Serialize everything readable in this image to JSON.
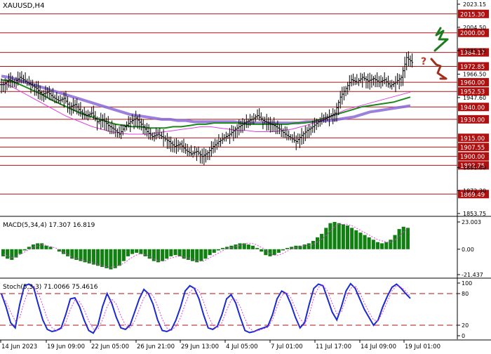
{
  "chart_data": [
    {
      "type": "line",
      "title": "XAUUSD,H4",
      "xlabel": "",
      "ylabel": "",
      "ylim": [
        1853.75,
        2023.15
      ],
      "yticks": [
        {
          "value": 2023.15,
          "label": "2023.15"
        },
        {
          "value": 2004.5,
          "label": "2004.50"
        },
        {
          "value": 1985.55,
          "label": "1985.55"
        },
        {
          "value": 1966.5,
          "label": "1966.50"
        },
        {
          "value": 1947.6,
          "label": "1947.60"
        },
        {
          "value": 1891.0,
          "label": "1891.00"
        },
        {
          "value": 1872.3,
          "label": "1872.30"
        },
        {
          "value": 1853.75,
          "label": "1853.75"
        }
      ],
      "categories": [
        "14 Jun 2023",
        "19 Jun 09:00",
        "22 Jun 05:00",
        "26 Jun 21:00",
        "29 Jun 13:00",
        "4 Jul 05:00",
        "7 Jul 01:00",
        "11 Jul 17:00",
        "14 Jul 09:00",
        "19 Jul 01:00"
      ],
      "levels": [
        {
          "value": 2015.3,
          "label": "2015.30"
        },
        {
          "value": 2000.0,
          "label": "2000.00"
        },
        {
          "value": 1984.17,
          "label": "1984.17"
        },
        {
          "value": 1972.85,
          "label": "1972.85"
        },
        {
          "value": 1960.0,
          "label": "1960.00"
        },
        {
          "value": 1952.53,
          "label": "1952.53"
        },
        {
          "value": 1940.0,
          "label": "1940.00"
        },
        {
          "value": 1930.0,
          "label": "1930.00"
        },
        {
          "value": 1915.0,
          "label": "1915.00"
        },
        {
          "value": 1907.55,
          "label": "1907.55"
        },
        {
          "value": 1900.0,
          "label": "1900.00"
        },
        {
          "value": 1892.75,
          "label": "1892.75"
        },
        {
          "value": 1869.49,
          "label": "1869.49"
        }
      ],
      "close": [
        1958,
        1962,
        1960,
        1964,
        1961,
        1958,
        1955,
        1950,
        1952,
        1948,
        1945,
        1947,
        1940,
        1942,
        1936,
        1933,
        1935,
        1928,
        1930,
        1925,
        1922,
        1918,
        1924,
        1928,
        1931,
        1926,
        1920,
        1916,
        1918,
        1915,
        1912,
        1908,
        1910,
        1905,
        1902,
        1904,
        1900,
        1903,
        1908,
        1912,
        1915,
        1918,
        1922,
        1925,
        1928,
        1930,
        1933,
        1929,
        1927,
        1925,
        1922,
        1918,
        1915,
        1912,
        1917,
        1921,
        1924,
        1928,
        1930,
        1932,
        1935,
        1948,
        1955,
        1962,
        1960,
        1964,
        1961,
        1963,
        1960,
        1962,
        1957,
        1960,
        1964,
        1980,
        1976
      ],
      "series": [
        {
          "name": "",
          "color": "#8a6ad8",
          "values": [
            1965,
            1964,
            1962,
            1960,
            1958,
            1956,
            1954,
            1952,
            1950,
            1948,
            1946,
            1944,
            1942,
            1940,
            1938,
            1936,
            1934,
            1933,
            1932,
            1931,
            1930,
            1930,
            1929,
            1929,
            1928,
            1928,
            1928,
            1928,
            1928,
            1928,
            1927,
            1927,
            1927,
            1927,
            1927,
            1927,
            1927,
            1927,
            1928,
            1928,
            1929,
            1929,
            1930,
            1931,
            1932,
            1934,
            1936,
            1937,
            1938,
            1939,
            1940,
            1941
          ]
        },
        {
          "name": "",
          "color": "#1a8a1a",
          "values": [
            1962,
            1961,
            1959,
            1956,
            1953,
            1950,
            1946,
            1943,
            1940,
            1937,
            1934,
            1932,
            1930,
            1928,
            1926,
            1925,
            1924,
            1924,
            1923,
            1923,
            1923,
            1924,
            1924,
            1925,
            1926,
            1926,
            1927,
            1927,
            1927,
            1927,
            1926,
            1926,
            1926,
            1926,
            1926,
            1926,
            1927,
            1927,
            1928,
            1930,
            1932,
            1934,
            1936,
            1938,
            1940,
            1941,
            1942,
            1943,
            1944,
            1946,
            1948
          ]
        },
        {
          "name": "",
          "color": "#e040e0",
          "values": [
            1960,
            1957,
            1953,
            1949,
            1945,
            1941,
            1937,
            1933,
            1930,
            1927,
            1924,
            1922,
            1920,
            1919,
            1918,
            1918,
            1918,
            1919,
            1920,
            1921,
            1922,
            1923,
            1924,
            1924,
            1923,
            1922,
            1921,
            1921,
            1920,
            1920,
            1920,
            1921,
            1922,
            1924,
            1926,
            1929,
            1932,
            1935,
            1938,
            1940,
            1942,
            1944,
            1946,
            1948,
            1950,
            1952
          ]
        }
      ],
      "annotations": [
        "?"
      ]
    },
    {
      "type": "bar",
      "title": "MACD(5,34,4) 17.307 16.819",
      "ylim": [
        -21.437,
        23.003
      ],
      "yticks": [
        {
          "value": 23.003,
          "label": "23.003"
        },
        {
          "value": 0.0,
          "label": "0.00"
        },
        {
          "value": -21.437,
          "label": "-21.437"
        }
      ],
      "values": [
        -6,
        -8,
        -9,
        -7,
        -4,
        -1,
        2,
        4,
        5,
        5,
        3,
        2,
        0,
        -2,
        -4,
        -6,
        -8,
        -9,
        -10,
        -11,
        -12,
        -13,
        -14,
        -15,
        -16,
        -17,
        -16,
        -14,
        -10,
        -6,
        -4,
        -3,
        -4,
        -6,
        -8,
        -10,
        -11,
        -10,
        -8,
        -6,
        -5,
        -6,
        -8,
        -9,
        -10,
        -11,
        -10,
        -8,
        -5,
        -3,
        -1,
        1,
        2,
        3,
        4,
        5,
        5,
        4,
        3,
        1,
        -2,
        -5,
        -6,
        -5,
        -3,
        -1,
        1,
        2,
        3,
        3,
        4,
        5,
        7,
        10,
        13,
        18,
        22,
        23,
        22,
        21,
        20,
        18,
        16,
        14,
        12,
        10,
        8,
        6,
        5,
        6,
        8,
        12,
        17,
        19,
        18
      ],
      "series": [
        {
          "name": "",
          "color": "#e040e0",
          "values": [
            -4,
            -6,
            -7,
            -6,
            -4,
            -2,
            0,
            2,
            3,
            4,
            3,
            2,
            1,
            -1,
            -3,
            -5,
            -7,
            -8,
            -9,
            -10,
            -11,
            -12,
            -13,
            -14,
            -15,
            -15,
            -14,
            -13,
            -11,
            -8,
            -6,
            -4,
            -4,
            -5,
            -7,
            -9,
            -10,
            -10,
            -8,
            -7,
            -6,
            -6,
            -7,
            -8,
            -9,
            -10,
            -10,
            -8,
            -6,
            -4,
            -2,
            0,
            1,
            2,
            3,
            4,
            5,
            5,
            4,
            2,
            0,
            -3,
            -5,
            -5,
            -4,
            -2,
            0,
            1,
            2,
            3,
            3,
            4,
            6,
            8,
            11,
            15,
            19,
            21,
            21,
            21,
            20,
            18,
            16,
            14,
            12,
            10,
            8,
            7,
            6,
            6,
            8,
            11,
            15,
            17
          ]
        }
      ]
    },
    {
      "type": "line",
      "title": "Stoch(5,3,3) 71.0066 75.4616",
      "ylim": [
        0,
        100
      ],
      "yticks": [
        {
          "value": 100,
          "label": "100"
        },
        {
          "value": 80,
          "label": "80"
        },
        {
          "value": 20,
          "label": "20"
        },
        {
          "value": 0,
          "label": "0"
        }
      ],
      "levels": [
        80,
        20
      ],
      "series": [
        {
          "name": "",
          "color": "#1a2ad0",
          "values": [
            80,
            55,
            25,
            15,
            60,
            95,
            98,
            92,
            60,
            30,
            12,
            8,
            10,
            15,
            40,
            70,
            72,
            55,
            30,
            10,
            5,
            20,
            55,
            80,
            62,
            35,
            15,
            12,
            20,
            45,
            70,
            88,
            80,
            60,
            30,
            10,
            8,
            12,
            30,
            55,
            85,
            95,
            90,
            70,
            40,
            15,
            12,
            18,
            40,
            70,
            78,
            62,
            35,
            10,
            6,
            8,
            12,
            15,
            18,
            40,
            70,
            85,
            80,
            60,
            35,
            15,
            25,
            60,
            90,
            98,
            95,
            70,
            45,
            30,
            55,
            85,
            99,
            90,
            70,
            50,
            35,
            20,
            30,
            55,
            75,
            92,
            98,
            90,
            80,
            71
          ]
        },
        {
          "name": "",
          "color": "#e040e0",
          "values": [
            75,
            65,
            45,
            28,
            35,
            65,
            88,
            95,
            82,
            58,
            32,
            15,
            10,
            12,
            25,
            50,
            68,
            65,
            50,
            28,
            13,
            12,
            30,
            55,
            70,
            60,
            38,
            20,
            15,
            28,
            50,
            72,
            82,
            76,
            56,
            32,
            15,
            10,
            18,
            35,
            60,
            82,
            92,
            85,
            65,
            38,
            20,
            15,
            25,
            48,
            68,
            70,
            55,
            32,
            14,
            8,
            10,
            13,
            16,
            30,
            55,
            76,
            82,
            72,
            52,
            32,
            22,
            40,
            72,
            92,
            96,
            85,
            62,
            42,
            45,
            70,
            90,
            95,
            82,
            62,
            45,
            30,
            28,
            45,
            65,
            85,
            95,
            92,
            85,
            75
          ]
        }
      ]
    }
  ],
  "annotation_question": "?"
}
